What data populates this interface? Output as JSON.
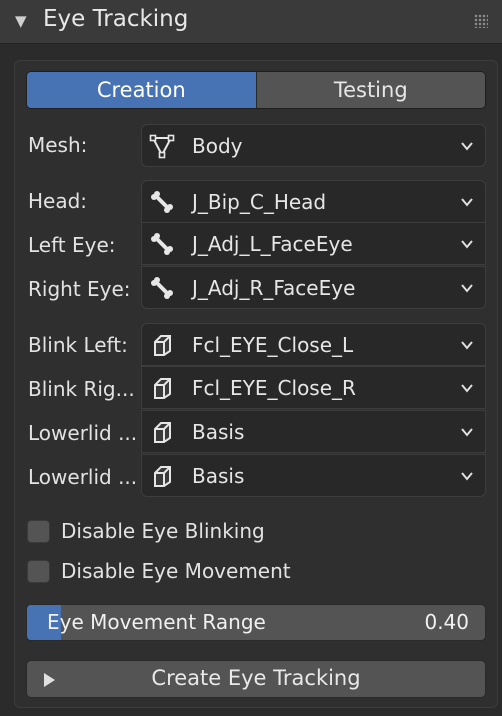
{
  "panel": {
    "title": "Eye Tracking",
    "collapse_icon": "triangle-down-icon",
    "grip_icon": "drag-grip-icon"
  },
  "tabs": [
    {
      "label": "Creation",
      "active": true
    },
    {
      "label": "Testing",
      "active": false
    }
  ],
  "fields": {
    "mesh": {
      "label": "Mesh:",
      "value": "Body",
      "icon": "mesh-icon"
    },
    "head": {
      "label": "Head:",
      "value": "J_Bip_C_Head",
      "icon": "bone-icon"
    },
    "left_eye": {
      "label": "Left Eye:",
      "value": "J_Adj_L_FaceEye",
      "icon": "bone-icon"
    },
    "right_eye": {
      "label": "Right Eye:",
      "value": "J_Adj_R_FaceEye",
      "icon": "bone-icon"
    },
    "blink_left": {
      "label": "Blink Left:",
      "value": "Fcl_EYE_Close_L",
      "icon": "shape-key-icon"
    },
    "blink_right": {
      "label": "Blink Rig...",
      "value": "Fcl_EYE_Close_R",
      "icon": "shape-key-icon"
    },
    "lowerlid_left": {
      "label": "Lowerlid ...",
      "value": "Basis",
      "icon": "shape-key-icon"
    },
    "lowerlid_right": {
      "label": "Lowerlid ...",
      "value": "Basis",
      "icon": "shape-key-icon"
    }
  },
  "checkboxes": {
    "disable_blinking": {
      "label": "Disable Eye Blinking",
      "checked": false
    },
    "disable_movement": {
      "label": "Disable Eye Movement",
      "checked": false
    }
  },
  "slider": {
    "label": "Eye Movement Range",
    "value_text": "0.40",
    "value": 0.4,
    "min": 0,
    "max": 1
  },
  "button": {
    "label": "Create Eye Tracking",
    "icon": "play-icon"
  },
  "colors": {
    "accent": "#4772b3",
    "background": "#2b2b2b",
    "widget": "#545454"
  }
}
